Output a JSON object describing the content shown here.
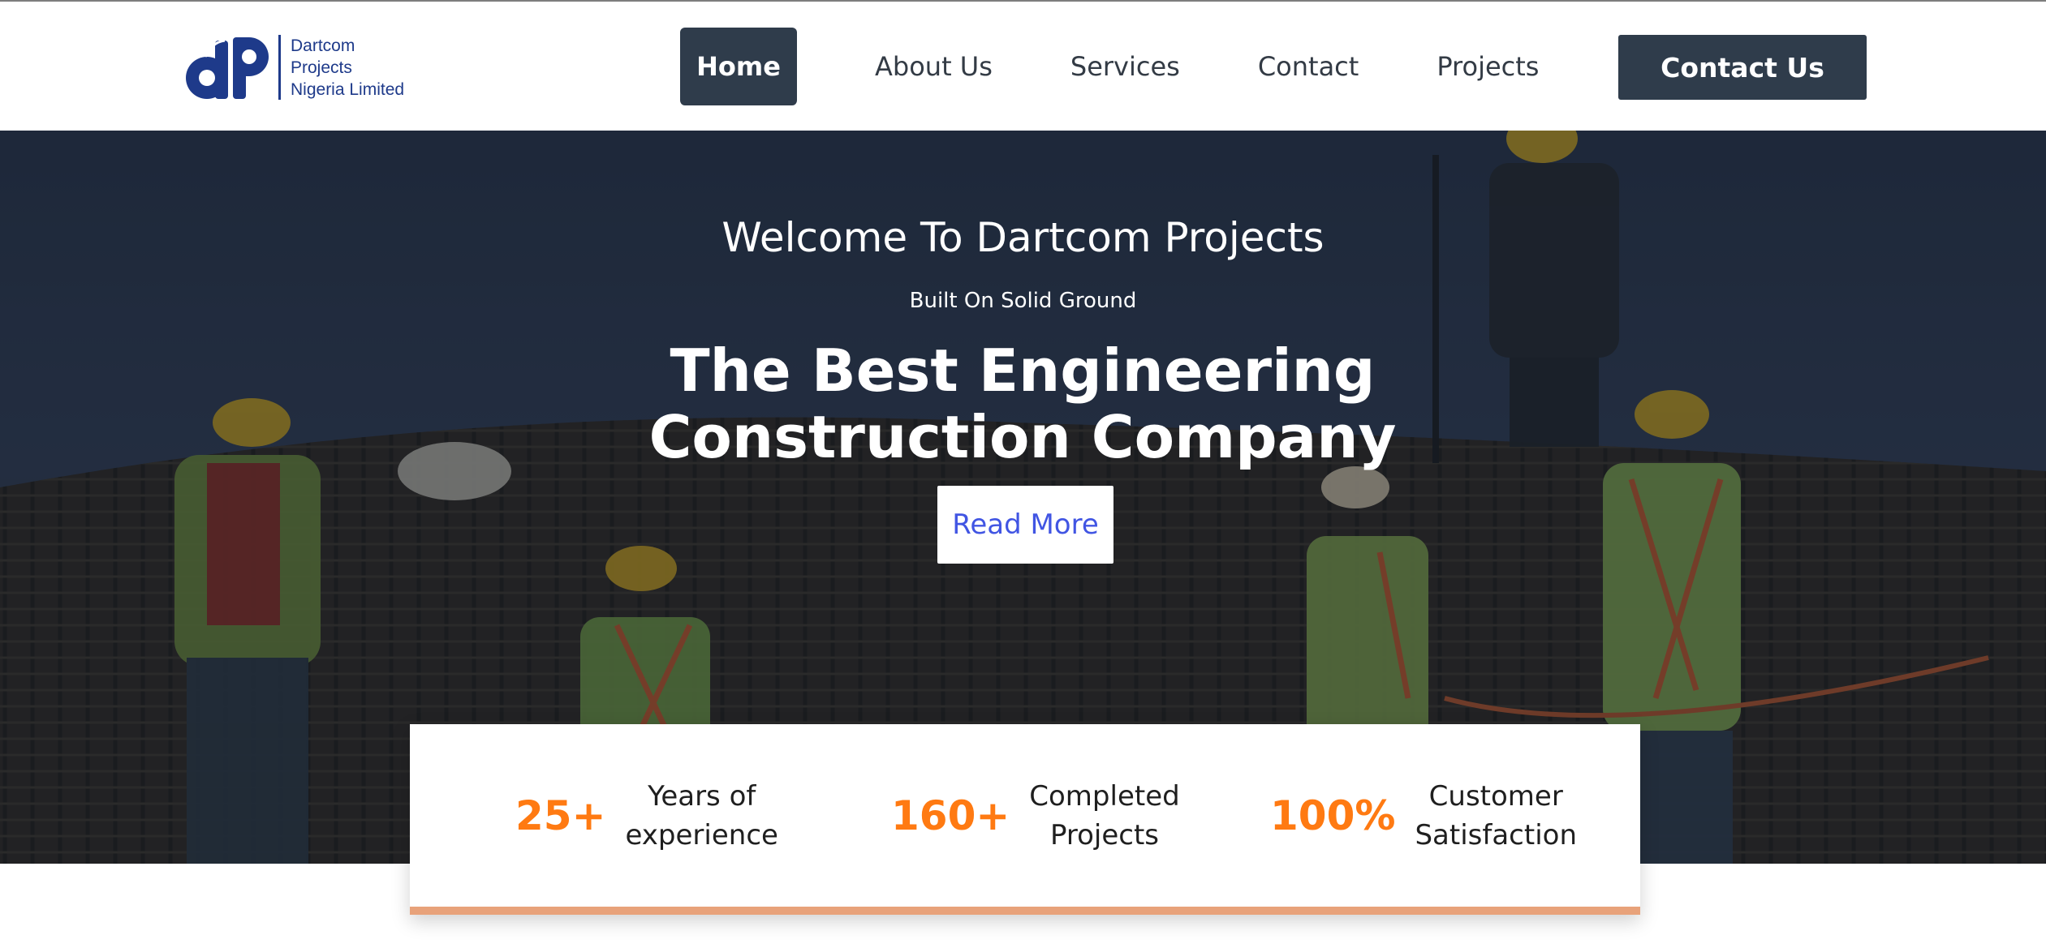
{
  "brand": {
    "name_lines": [
      "Dartcom",
      "Projects",
      "Nigeria Limited"
    ],
    "logo_color": "#1e3a8a",
    "logo_icon": "dp-monogram-logo"
  },
  "nav": {
    "items": [
      {
        "label": "Home",
        "active": true
      },
      {
        "label": "About Us",
        "active": false
      },
      {
        "label": "Services",
        "active": false
      },
      {
        "label": "Contact",
        "active": false
      },
      {
        "label": "Projects",
        "active": false
      }
    ],
    "cta_label": "Contact Us",
    "active_bg": "#2f3c4b"
  },
  "hero": {
    "welcome": "Welcome To Dartcom Projects",
    "subtitle": "Built On Solid Ground",
    "title": "The Best Engineering Construction Company",
    "button_label": "Read More",
    "button_text_color": "#4155e3",
    "background": "construction-workers-on-rebar-cage-photo"
  },
  "stats": [
    {
      "value": "25+",
      "label": "Years of\nexperience"
    },
    {
      "value": "160+",
      "label": "Completed\nProjects"
    },
    {
      "value": "100%",
      "label": "Customer\nSatisfaction"
    }
  ],
  "colors": {
    "accent": "#ff7a12",
    "stats_border": "#e8a27a",
    "dark": "#2f3c4b"
  }
}
